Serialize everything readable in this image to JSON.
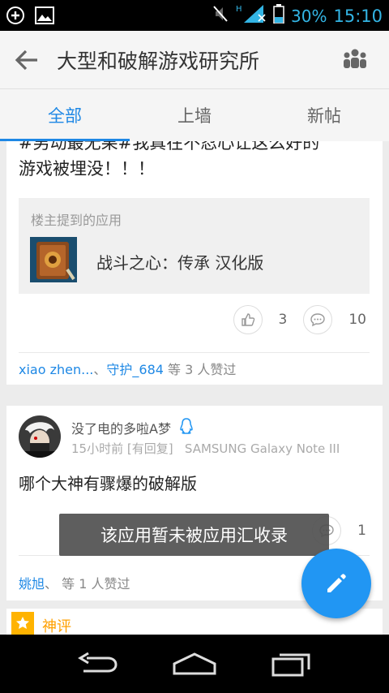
{
  "status_bar": {
    "battery": "30%",
    "time": "15:10",
    "network": "H",
    "icons": [
      "add-circle-icon",
      "image-icon",
      "mute-icon",
      "signal-icon",
      "battery-icon"
    ]
  },
  "app_bar": {
    "title": "大型和破解游戏研究所",
    "back_icon": "back-arrow-icon",
    "members_icon": "people-icon"
  },
  "tabs": [
    {
      "label": "全部",
      "active": true
    },
    {
      "label": "上墙",
      "active": false
    },
    {
      "label": "新帖",
      "active": false
    }
  ],
  "post1": {
    "text_line1": "#男动最无果#我真在不忍心让这么好的",
    "text_line2": "游戏被埋没！！！",
    "app_box": {
      "label": "楼主提到的应用",
      "app_name": "战斗之心：传承 汉化版"
    },
    "likes_count": "3",
    "comments_count": "10",
    "liked_by": {
      "user1": "xiao zhen...",
      "sep": "、",
      "user2": "守护_684",
      "suffix": " 等 3 人赞过"
    }
  },
  "post2": {
    "username": "没了电的多啦A梦",
    "time": "15小时前",
    "reply_tag": "[有回复]",
    "device": "SAMSUNG Galaxy Note III",
    "text": "哪个大神有骤爆的破解版",
    "comments_count": "1",
    "liked_by": {
      "user1": "姚旭",
      "sep": "、",
      "suffix": " 等 1 人赞过"
    }
  },
  "post3": {
    "badge_label": "神评"
  },
  "toast": {
    "text": "该应用暂未被应用汇收录"
  },
  "colors": {
    "accent": "#1e88e5",
    "fab": "#2196f3",
    "badge": "#ffb300"
  }
}
